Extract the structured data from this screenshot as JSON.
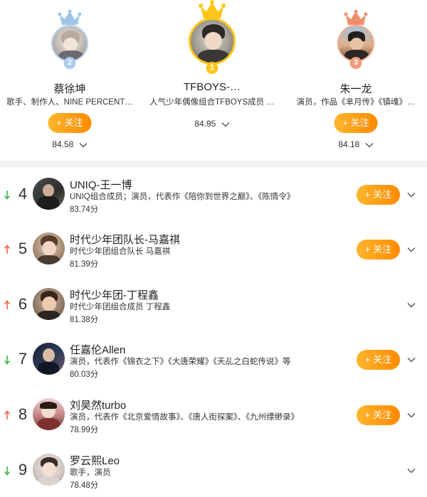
{
  "colors": {
    "accent": "#ff9a0e",
    "rank_up": "#f0624c",
    "rank_down": "#39b54a",
    "crown_gold": "#ffc61a",
    "crown_silver": "#9fc6e8",
    "crown_bronze": "#f08d6a"
  },
  "top3": [
    {
      "rank": "2",
      "name": "蔡徐坤",
      "desc": "歌手、制作人、NINE PERCENT…",
      "follow_label": "关注",
      "score": "84.58",
      "crown": "silver-crown-icon"
    },
    {
      "rank": "1",
      "name": "TFBOYS-…",
      "desc": "人气少年偶像组合TFBOYS成员 …",
      "follow_label": "",
      "score": "84.95",
      "crown": "gold-crown-icon"
    },
    {
      "rank": "3",
      "name": "朱一龙",
      "desc": "演员，作品《芈月传》《镇魂》…",
      "follow_label": "关注",
      "score": "84.18",
      "crown": "bronze-crown-icon"
    }
  ],
  "list": [
    {
      "rank": "4",
      "trend": "down",
      "name": "UNIQ-王一博",
      "desc": "UNIQ组合成员；演员，代表作《陪你到世界之巅》、《陈情令》",
      "score": "83.74分",
      "follow_label": "关注"
    },
    {
      "rank": "5",
      "trend": "up",
      "name": "时代少年团队长-马嘉祺",
      "desc": "时代少年团组合队长 马嘉祺",
      "score": "81.39分",
      "follow_label": "关注"
    },
    {
      "rank": "6",
      "trend": "up",
      "name": "时代少年团-丁程鑫",
      "desc": "时代少年团组合成员 丁程鑫",
      "score": "81.38分",
      "follow_label": ""
    },
    {
      "rank": "7",
      "trend": "down",
      "name": "任嘉伦Allen",
      "desc": "演员，代表作《锦衣之下》《大唐荣耀》《天乩之白蛇传说》等",
      "score": "80.03分",
      "follow_label": "关注"
    },
    {
      "rank": "8",
      "trend": "up",
      "name": "刘昊然turbo",
      "desc": "演员，代表作《北京爱情故事》、《唐人街探案》、《九州缥缈录》",
      "score": "78.99分",
      "follow_label": "关注"
    },
    {
      "rank": "9",
      "trend": "down",
      "name": "罗云熙Leo",
      "desc": "歌手，演员",
      "score": "78.48分",
      "follow_label": ""
    }
  ]
}
